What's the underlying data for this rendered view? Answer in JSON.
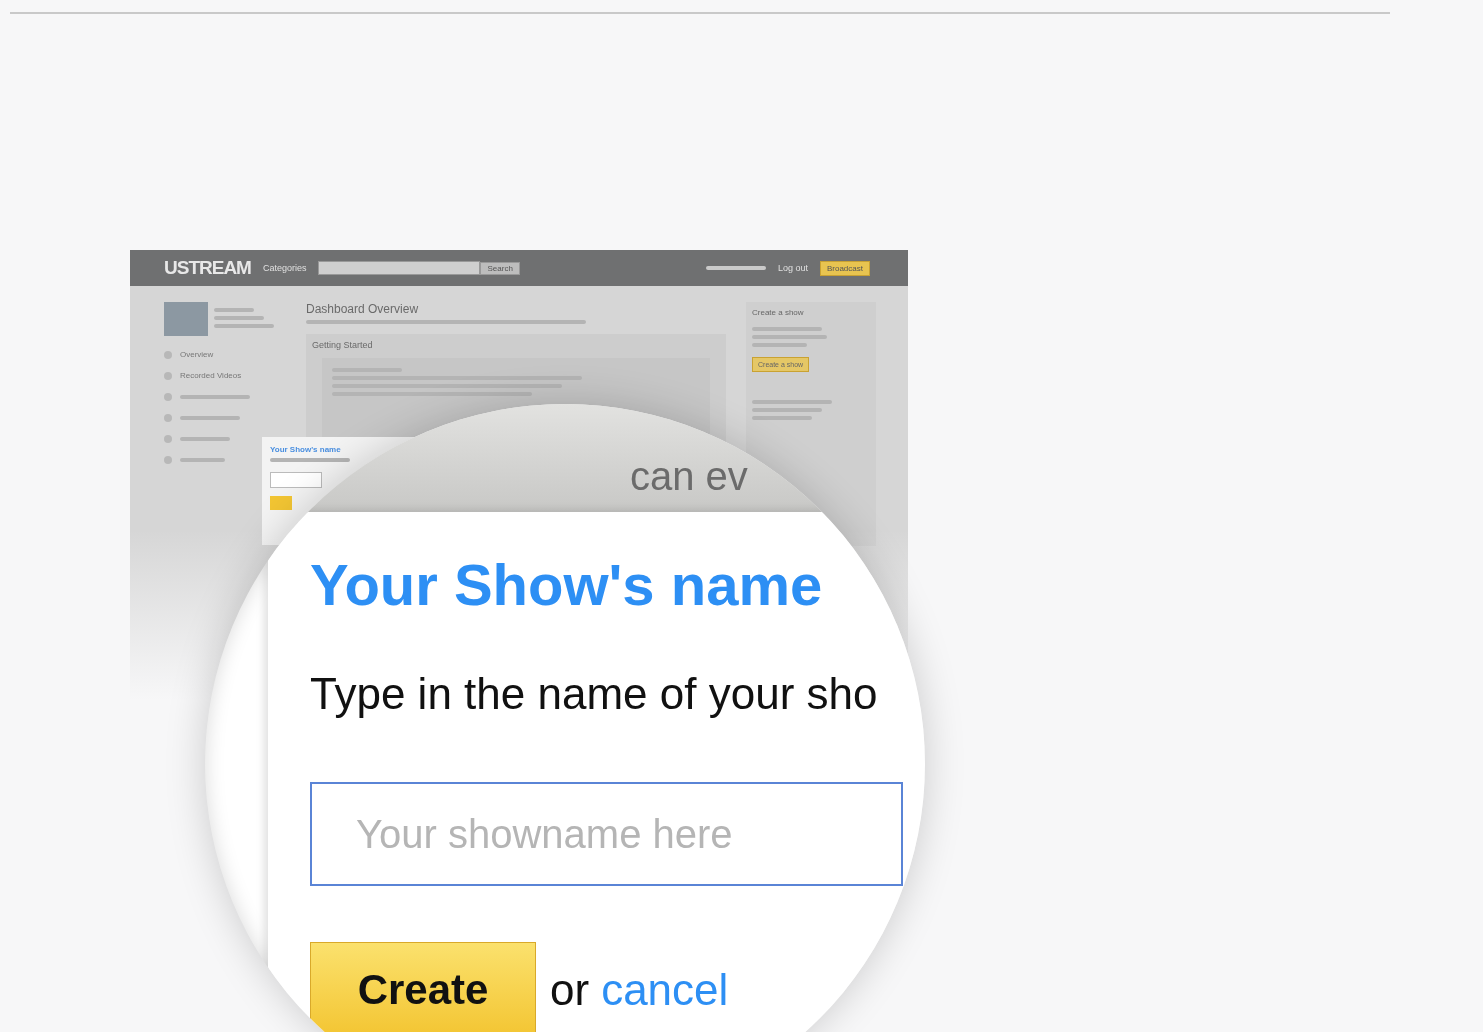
{
  "mini_screenshot": {
    "header": {
      "logo": "USTREAM",
      "nav": "Categories",
      "search_button": "Search",
      "logout": "Log out",
      "broadcast": "Broadcast"
    },
    "sidebar": {
      "items": [
        "Overview",
        "Recorded Videos"
      ]
    },
    "main": {
      "title": "Dashboard Overview",
      "section": "Getting Started"
    },
    "right_panel": {
      "title": "Create a show",
      "button": "Create a show"
    },
    "dialog": {
      "title": "Your Show's name"
    }
  },
  "magnifier": {
    "background_text": "can ev",
    "dialog": {
      "title": "Your Show's name",
      "prompt": "Type in the name of your sho",
      "input": {
        "placeholder": "Your showname here"
      },
      "create_button": "Create",
      "or_text": "or",
      "cancel_link": "cancel"
    }
  }
}
